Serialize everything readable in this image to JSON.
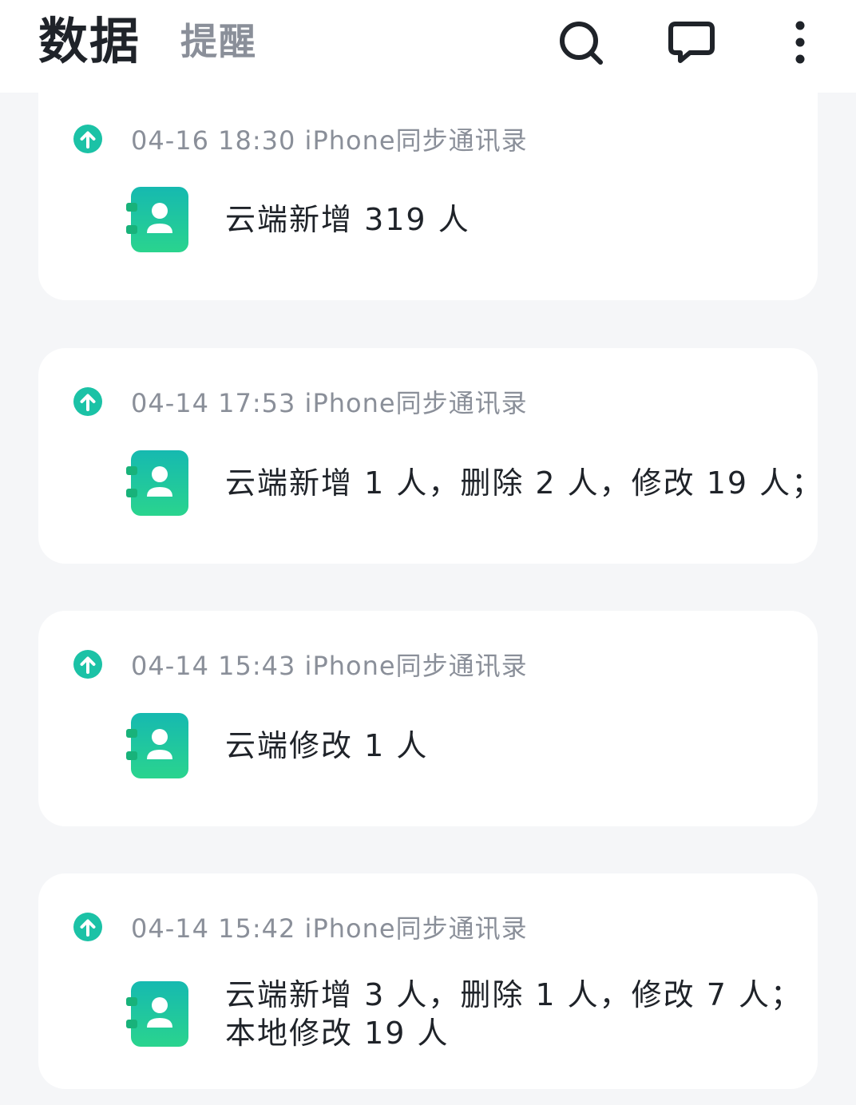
{
  "header": {
    "active_tab": "数据",
    "inactive_tab": "提醒",
    "icons": [
      "search-icon",
      "chat-icon",
      "more-vertical-icon"
    ]
  },
  "colors": {
    "accent": "#1bc2a6",
    "card_bg": "#ffffff",
    "page_bg": "#f5f6f8",
    "meta_text": "#8a8f99",
    "primary_text": "#1f2329"
  },
  "records": [
    {
      "meta": "04-16 18:30 iPhone同步通讯录",
      "summary_lines": [
        "云端新增 319 人"
      ],
      "status_icon": "upload-arrow-icon",
      "type_icon": "contacts-book-icon"
    },
    {
      "meta": "04-14 17:53 iPhone同步通讯录",
      "summary_lines": [
        "云端新增 1 人，删除 2 人，修改 19 人；"
      ],
      "status_icon": "upload-arrow-icon",
      "type_icon": "contacts-book-icon"
    },
    {
      "meta": "04-14 15:43 iPhone同步通讯录",
      "summary_lines": [
        "云端修改 1 人"
      ],
      "status_icon": "upload-arrow-icon",
      "type_icon": "contacts-book-icon"
    },
    {
      "meta": "04-14 15:42 iPhone同步通讯录",
      "summary_lines": [
        "云端新增 3 人，删除 1 人，修改 7 人；",
        "本地修改 19 人"
      ],
      "status_icon": "upload-arrow-icon",
      "type_icon": "contacts-book-icon"
    }
  ]
}
